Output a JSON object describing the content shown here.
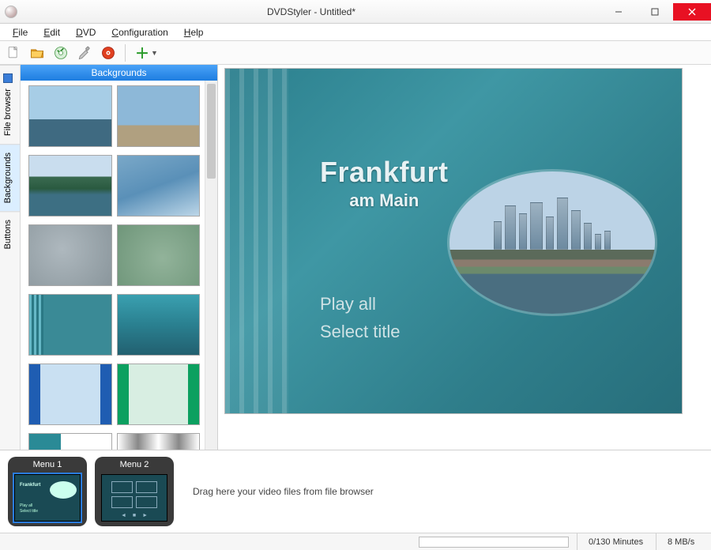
{
  "window": {
    "title": "DVDStyler - Untitled*"
  },
  "menubar": {
    "file": "File",
    "edit": "Edit",
    "dvd": "DVD",
    "configuration": "Configuration",
    "help": "Help"
  },
  "side_tabs": {
    "file_browser": "File browser",
    "backgrounds": "Backgrounds",
    "buttons": "Buttons"
  },
  "bg_panel": {
    "header": "Backgrounds"
  },
  "preview": {
    "title_main": "Frankfurt",
    "title_sub": "am Main",
    "link_play_all": "Play all",
    "link_select_title": "Select title"
  },
  "timeline": {
    "menu1_label": "Menu 1",
    "menu2_label": "Menu 2",
    "drop_hint": "Drag here your video files from file browser"
  },
  "statusbar": {
    "minutes": "0/130 Minutes",
    "speed": "8 MB/s"
  },
  "icons": {
    "new": "new-file",
    "open": "open-folder",
    "save": "save-dvd",
    "settings": "wrench",
    "burn": "burn-disc",
    "add": "add"
  }
}
